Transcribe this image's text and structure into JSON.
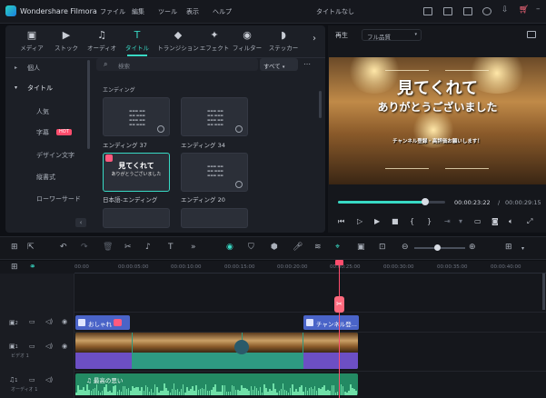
{
  "app": {
    "name": "Wondershare Filmora",
    "project_title": "タイトルなし",
    "menu": [
      "ファイル",
      "編集",
      "ツール",
      "表示",
      "ヘルプ"
    ]
  },
  "library": {
    "tabs": [
      {
        "label": "メディア",
        "icon": "media-icon"
      },
      {
        "label": "ストック",
        "icon": "stock-icon"
      },
      {
        "label": "オーディオ",
        "icon": "audio-icon"
      },
      {
        "label": "タイトル",
        "icon": "title-icon",
        "active": true
      },
      {
        "label": "トランジション",
        "icon": "transition-icon"
      },
      {
        "label": "エフェクト",
        "icon": "effect-icon"
      },
      {
        "label": "フィルター",
        "icon": "filter-icon"
      },
      {
        "label": "ステッカー",
        "icon": "sticker-icon"
      }
    ],
    "sidebar": [
      {
        "label": "個人"
      },
      {
        "label": "タイトル",
        "active": true
      },
      {
        "label": "人気"
      },
      {
        "label": "字幕",
        "badge": "HOT"
      },
      {
        "label": "デザイン文字"
      },
      {
        "label": "縦書式"
      },
      {
        "label": "ローワーサード"
      }
    ],
    "search_placeholder": "検索",
    "filter": "すべて",
    "category": "エンディング",
    "items": [
      {
        "name": "エンディング 37"
      },
      {
        "name": "エンディング 34"
      },
      {
        "name": "日本語-エンディング",
        "line1": "見てくれて",
        "line2": "ありがとうございました",
        "selected": true
      },
      {
        "name": "エンディング 20"
      }
    ]
  },
  "player": {
    "label": "再生",
    "quality": "フル品質",
    "text_line1": "見てくれて",
    "text_line2": "ありがとうございました",
    "text_line3": "チャンネル登録・高評価お願いします！",
    "current_time": "00:00:23:22",
    "separator": "/",
    "total_time": "00:00:29:15",
    "progress": 0.81
  },
  "timeline": {
    "ruler": [
      "00:00",
      "00:00:05:00",
      "00:00:10:00",
      "00:00:15:00",
      "00:00:20:00",
      "00:00:25:00",
      "00:00:30:00",
      "00:00:35:00",
      "00:00:40:00"
    ],
    "tracks": [
      {
        "num": "2"
      },
      {
        "num": "1",
        "label": "ビデオ 1"
      },
      {
        "num": "1",
        "label": "オーディオ 1"
      }
    ],
    "title_clips": [
      "おしゃれ",
      "チャンネル登..."
    ],
    "audio_clip": "最高の思い"
  },
  "colors": {
    "accent": "#38d9c4",
    "playhead": "#ff4d6d",
    "title_clip": "#4a64c8",
    "video_clip": "#2e9a82",
    "audio_clip": "#238a63"
  }
}
